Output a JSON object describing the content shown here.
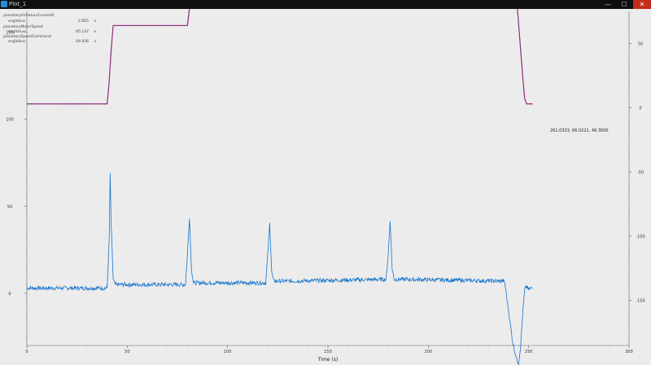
{
  "window": {
    "title": "Plot_1",
    "min_glyph": "—",
    "max_glyph": "☐",
    "close_glyph": "✕",
    "app_icon": "plot-app-icon"
  },
  "legend": [
    {
      "signal": "planetaryArmatureCurrentA",
      "field": "engValue",
      "value": "2.855",
      "color": "#1874cd"
    },
    {
      "signal": "planetaryMotorSpeed",
      "field": "engValue",
      "value": "65.147",
      "color": "#c8102e"
    },
    {
      "signal": "planetarySpeedCommand",
      "field": "engValue",
      "value": "64.936",
      "color": "#6a3fb0"
    }
  ],
  "legend_marker": "×",
  "readout": "261.0323, 66.0221, 46.3000",
  "colors": {
    "current": "#1874cd",
    "speed": "#c8102e",
    "command": "#6a3fb0",
    "plot_bg": "#ececec",
    "axis": "#555555"
  },
  "chart_data": {
    "type": "line",
    "xlabel": "Time (s)",
    "xlim": [
      0,
      300
    ],
    "x_ticks": [
      "0",
      "50",
      "100",
      "150",
      "200",
      "250",
      "300"
    ],
    "y_left": {
      "lim": [
        -30,
        162
      ],
      "ticks": [
        "0",
        "50",
        "100",
        "150"
      ]
    },
    "y_right": {
      "lim": [
        -185,
        75
      ],
      "ticks": [
        "50",
        "0",
        "-50",
        "-100",
        "-150"
      ]
    },
    "grid": false,
    "legend_position": "top-left",
    "series": [
      {
        "name": "planetaryArmatureCurrentA",
        "axis": "left",
        "x": [
          0,
          40,
          41,
          41.5,
          42,
          43,
          44,
          50,
          79,
          80,
          81,
          82,
          83,
          90,
          119,
          120,
          121,
          122,
          123,
          130,
          179,
          180,
          181,
          182,
          183,
          190,
          238,
          240,
          242,
          244,
          245,
          246,
          247,
          248,
          249,
          250,
          251,
          252
        ],
        "y": [
          3,
          3,
          30,
          68,
          40,
          8,
          5,
          5,
          5,
          22,
          44,
          14,
          6,
          6,
          6,
          22,
          40,
          12,
          7,
          7,
          8,
          22,
          42,
          14,
          8,
          8,
          7,
          -10,
          -28,
          -38,
          -40,
          -30,
          -12,
          2,
          4,
          2,
          3,
          3
        ]
      },
      {
        "name": "planetaryMotorSpeed",
        "axis": "right",
        "x": [
          0,
          40,
          41,
          42,
          43,
          80,
          81,
          82,
          83,
          120,
          121,
          122,
          123,
          180,
          181,
          182,
          183,
          240,
          241,
          243,
          245,
          247,
          248,
          249,
          252
        ],
        "y": [
          3,
          3,
          20,
          45,
          64,
          64,
          77,
          88,
          90,
          90,
          105,
          115,
          116,
          116,
          130,
          137,
          138,
          138,
          132,
          105,
          65,
          25,
          7,
          3,
          3
        ]
      },
      {
        "name": "planetarySpeedCommand",
        "axis": "right",
        "x": [
          0,
          40,
          41,
          42,
          43,
          80,
          81,
          82,
          83,
          120,
          121,
          122,
          123,
          180,
          181,
          182,
          183,
          240,
          241,
          243,
          245,
          247,
          248,
          249,
          252
        ],
        "y": [
          3,
          3,
          20,
          45,
          64,
          64,
          77,
          88,
          90,
          90,
          105,
          115,
          116,
          116,
          130,
          137,
          138,
          138,
          132,
          105,
          65,
          25,
          7,
          3,
          3
        ]
      }
    ]
  }
}
